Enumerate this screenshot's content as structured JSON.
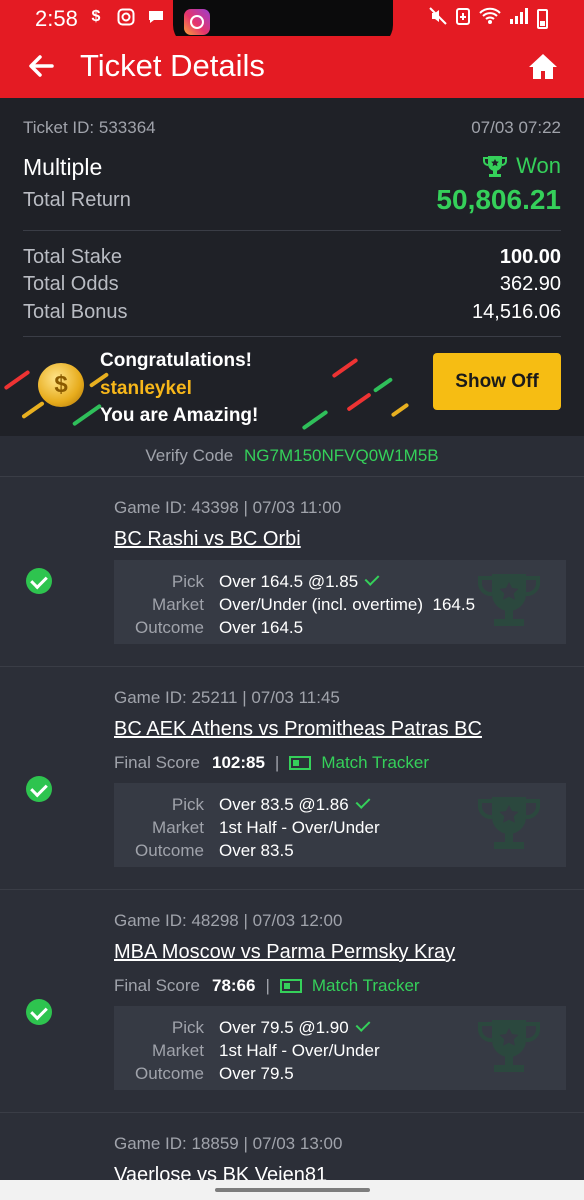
{
  "status_bar": {
    "time": "2:58"
  },
  "header": {
    "title": "Ticket Details"
  },
  "summary": {
    "ticket_id": "Ticket ID: 533364",
    "date": "07/03 07:22",
    "bet_type": "Multiple",
    "status": "Won",
    "total_return_label": "Total Return",
    "total_return": "50,806.21",
    "total_stake_label": "Total Stake",
    "total_stake": "100.00",
    "total_odds_label": "Total Odds",
    "total_odds": "362.90",
    "total_bonus_label": "Total Bonus",
    "total_bonus": "14,516.06"
  },
  "congrats": {
    "title": "Congratulations!",
    "username": "stanleykel",
    "message": "You are Amazing!",
    "button": "Show Off"
  },
  "verify": {
    "label": "Verify Code",
    "code": "NG7M150NFVQ0W1M5B"
  },
  "labels": {
    "pick": "Pick",
    "market": "Market",
    "outcome": "Outcome",
    "final_score": "Final Score",
    "match_tracker": "Match Tracker"
  },
  "games": [
    {
      "id_line": "Game ID: 43398 | 07/03 11:00",
      "match": "BC Rashi vs BC Orbi",
      "pick": "Over 164.5 @1.85",
      "market": "Over/Under (incl. overtime)  164.5",
      "outcome": "Over 164.5"
    },
    {
      "id_line": "Game ID: 25211 | 07/03 11:45",
      "match": "BC AEK Athens vs Promitheas Patras BC",
      "final_score": "102:85",
      "pick": "Over 83.5 @1.86",
      "market": "1st Half - Over/Under",
      "outcome": "Over 83.5"
    },
    {
      "id_line": "Game ID: 48298 | 07/03 12:00",
      "match": "MBA Moscow vs Parma Permsky Kray",
      "final_score": "78:66",
      "pick": "Over 79.5 @1.90",
      "market": "1st Half - Over/Under",
      "outcome": "Over 79.5"
    },
    {
      "id_line": "Game ID: 18859 | 07/03 13:00",
      "match": "Vaerlose vs BK Vejen81"
    }
  ],
  "colors": {
    "brand_red": "#e41b23",
    "win_green": "#35d05a",
    "accent_yellow": "#f6bd13"
  }
}
